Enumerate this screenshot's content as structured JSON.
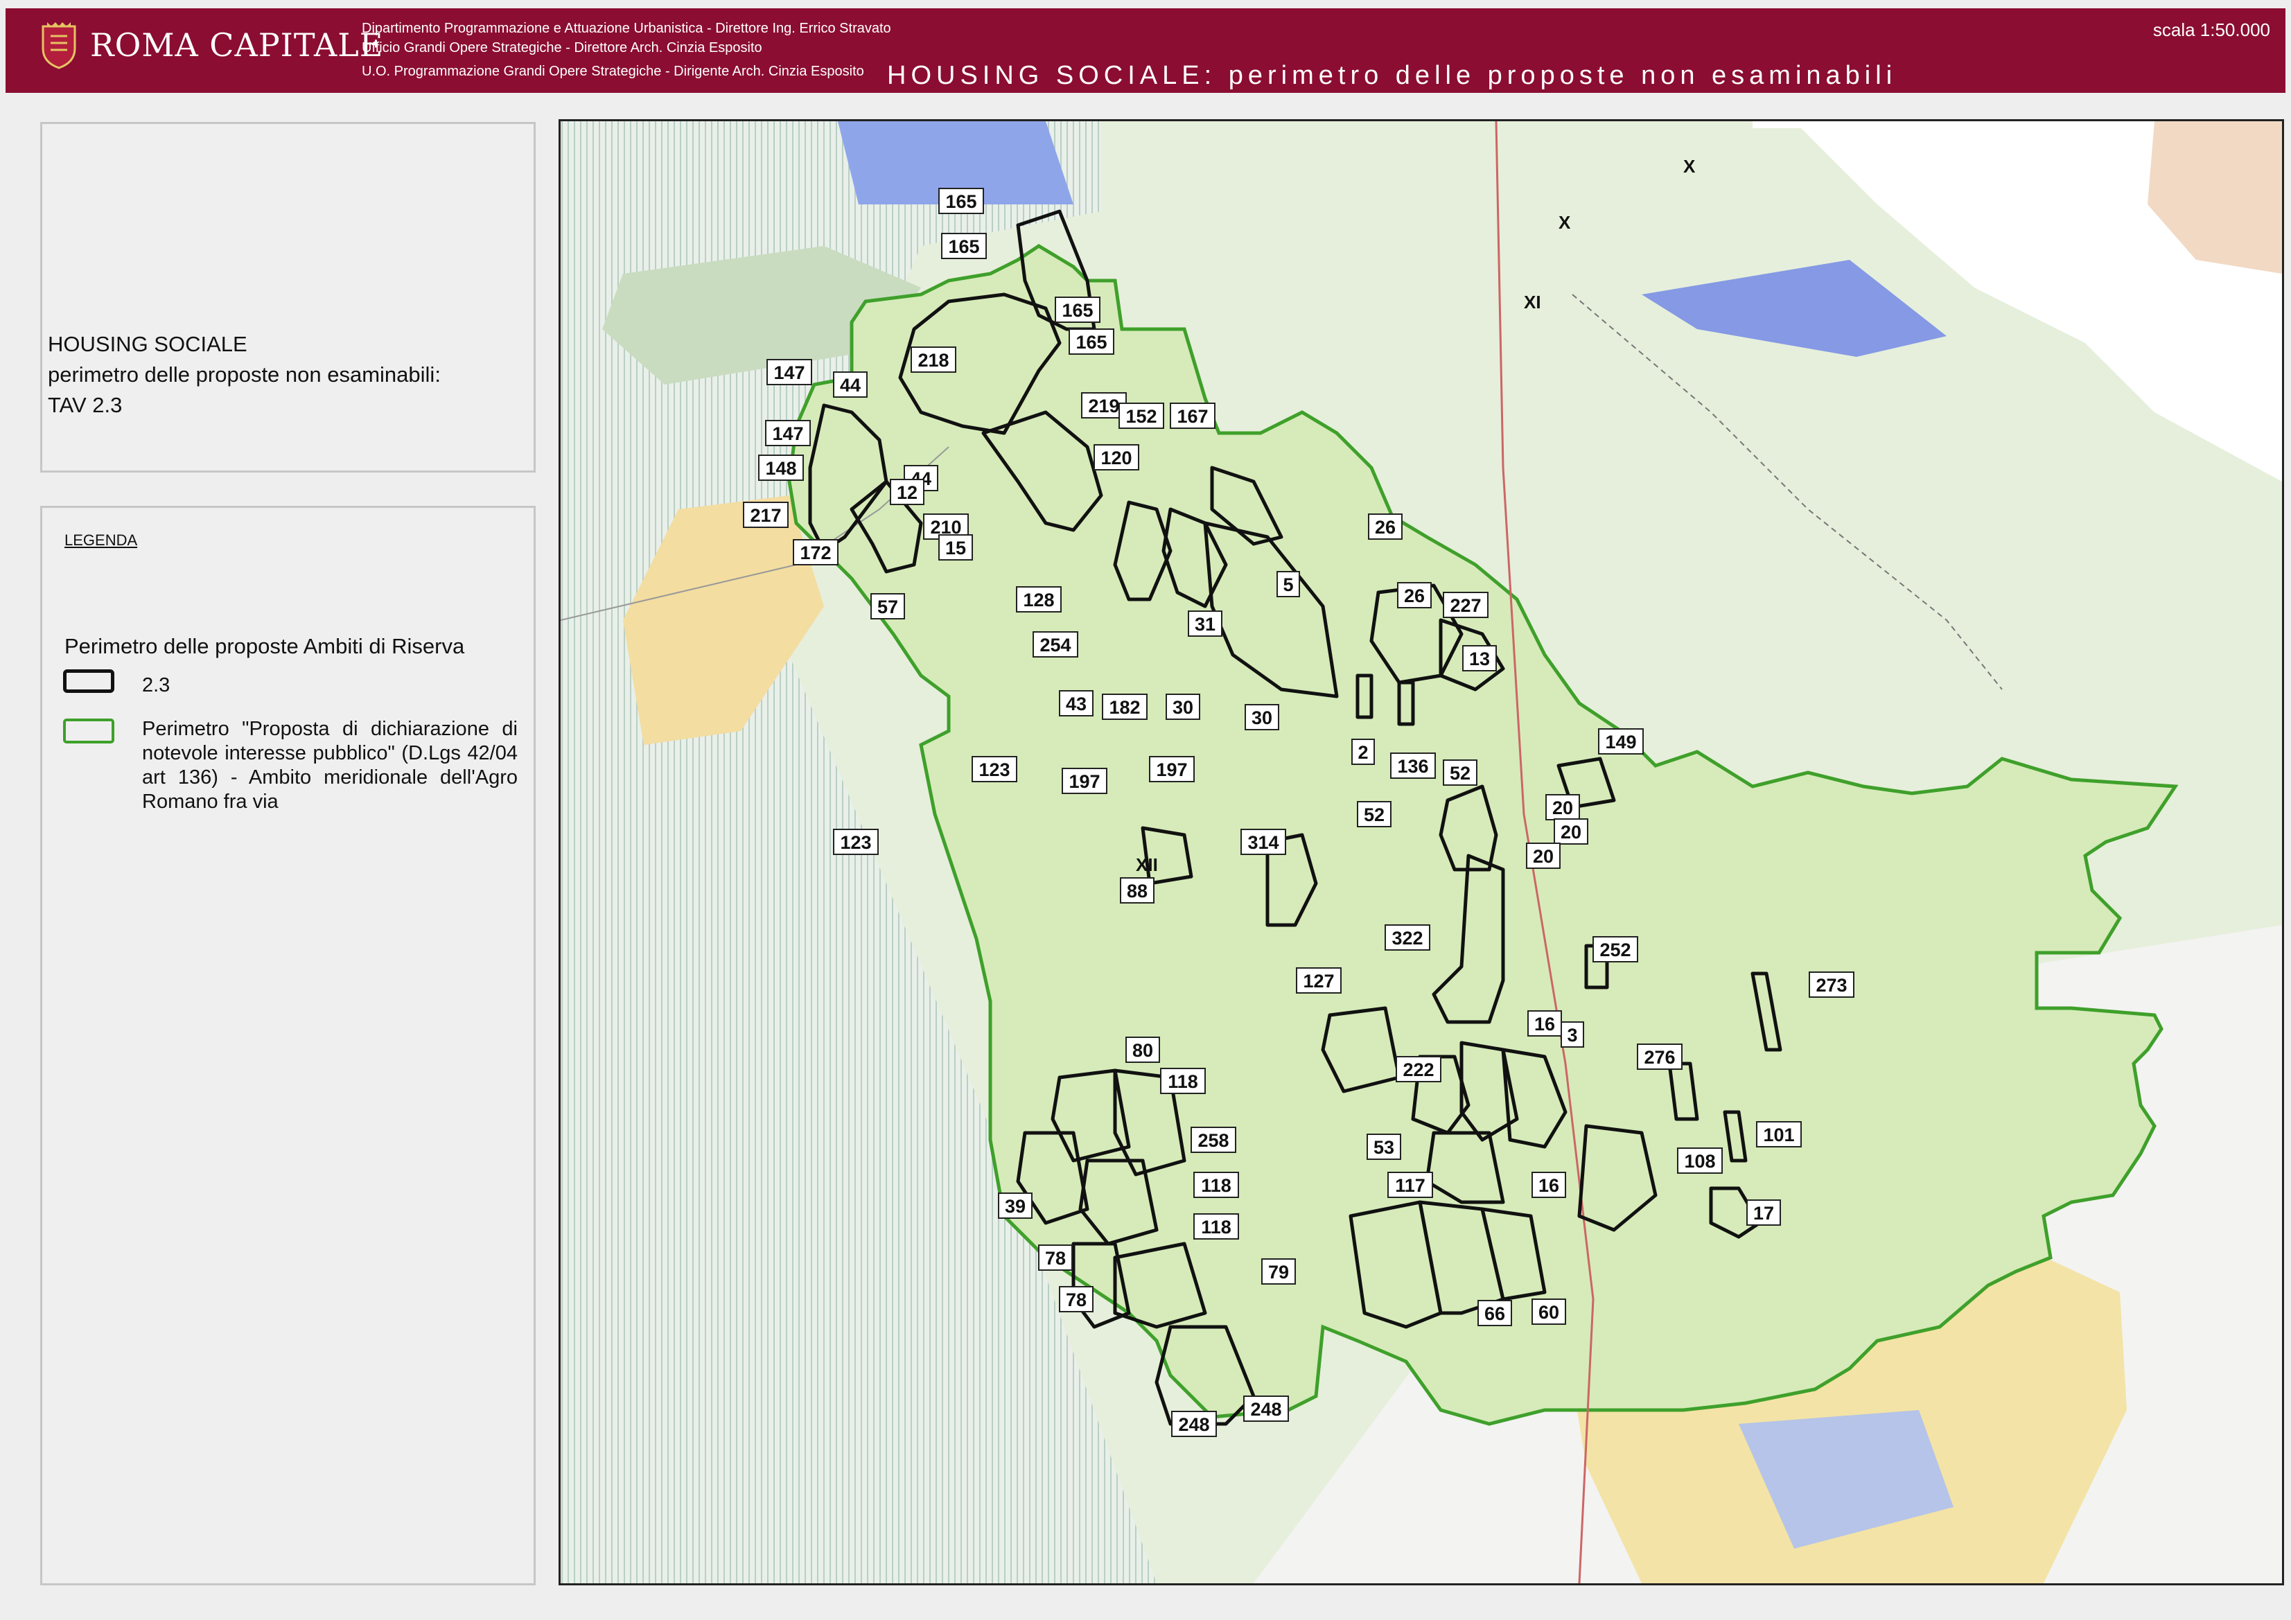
{
  "header": {
    "logo_text": "ROMA CAPITALE",
    "line1": "Dipartimento Programmazione e Attuazione Urbanistica - Direttore Ing. Errico Stravato",
    "line2": "Ufficio Grandi Opere Strategiche - Direttore Arch. Cinzia Esposito",
    "line3": "U.O. Programmazione Grandi Opere Strategiche - Dirigente Arch. Cinzia Esposito",
    "title": "HOUSING SOCIALE: perimetro delle proposte non esaminabili",
    "scale": "scala 1:50.000"
  },
  "title_panel": {
    "line1": "HOUSING SOCIALE",
    "line2": "perimetro delle proposte non esaminabili:",
    "line3": "TAV 2.3"
  },
  "legend": {
    "heading": "LEGENDA",
    "subheading": "Perimetro delle proposte Ambiti di Riserva",
    "black_label": "2.3",
    "green_label": "Perimetro \"Proposta di dichiarazione di notevole interesse pubblico\" (D.Lgs 42/04 art 136) - Ambito meridionale dell'Agro Romano fra via",
    "black_color": "#111111",
    "green_color": "#3fa02b"
  },
  "map": {
    "municipi": [
      "X",
      "X",
      "XI",
      "XII"
    ],
    "labels": [
      "165",
      "165",
      "165",
      "165",
      "218",
      "147",
      "44",
      "147",
      "148",
      "44",
      "217",
      "210",
      "172",
      "12",
      "219",
      "152",
      "167",
      "120",
      "15",
      "57",
      "128",
      "254",
      "31",
      "5",
      "26",
      "26",
      "227",
      "13",
      "43",
      "182",
      "30",
      "30",
      "2",
      "136",
      "149",
      "123",
      "197",
      "197",
      "52",
      "52",
      "20",
      "20",
      "20",
      "123",
      "314",
      "88",
      "322",
      "252",
      "127",
      "273",
      "16",
      "3",
      "80",
      "222",
      "276",
      "118",
      "101",
      "258",
      "53",
      "108",
      "118",
      "117",
      "16",
      "39",
      "118",
      "17",
      "79",
      "78",
      "78",
      "66",
      "60",
      "248",
      "248"
    ]
  }
}
